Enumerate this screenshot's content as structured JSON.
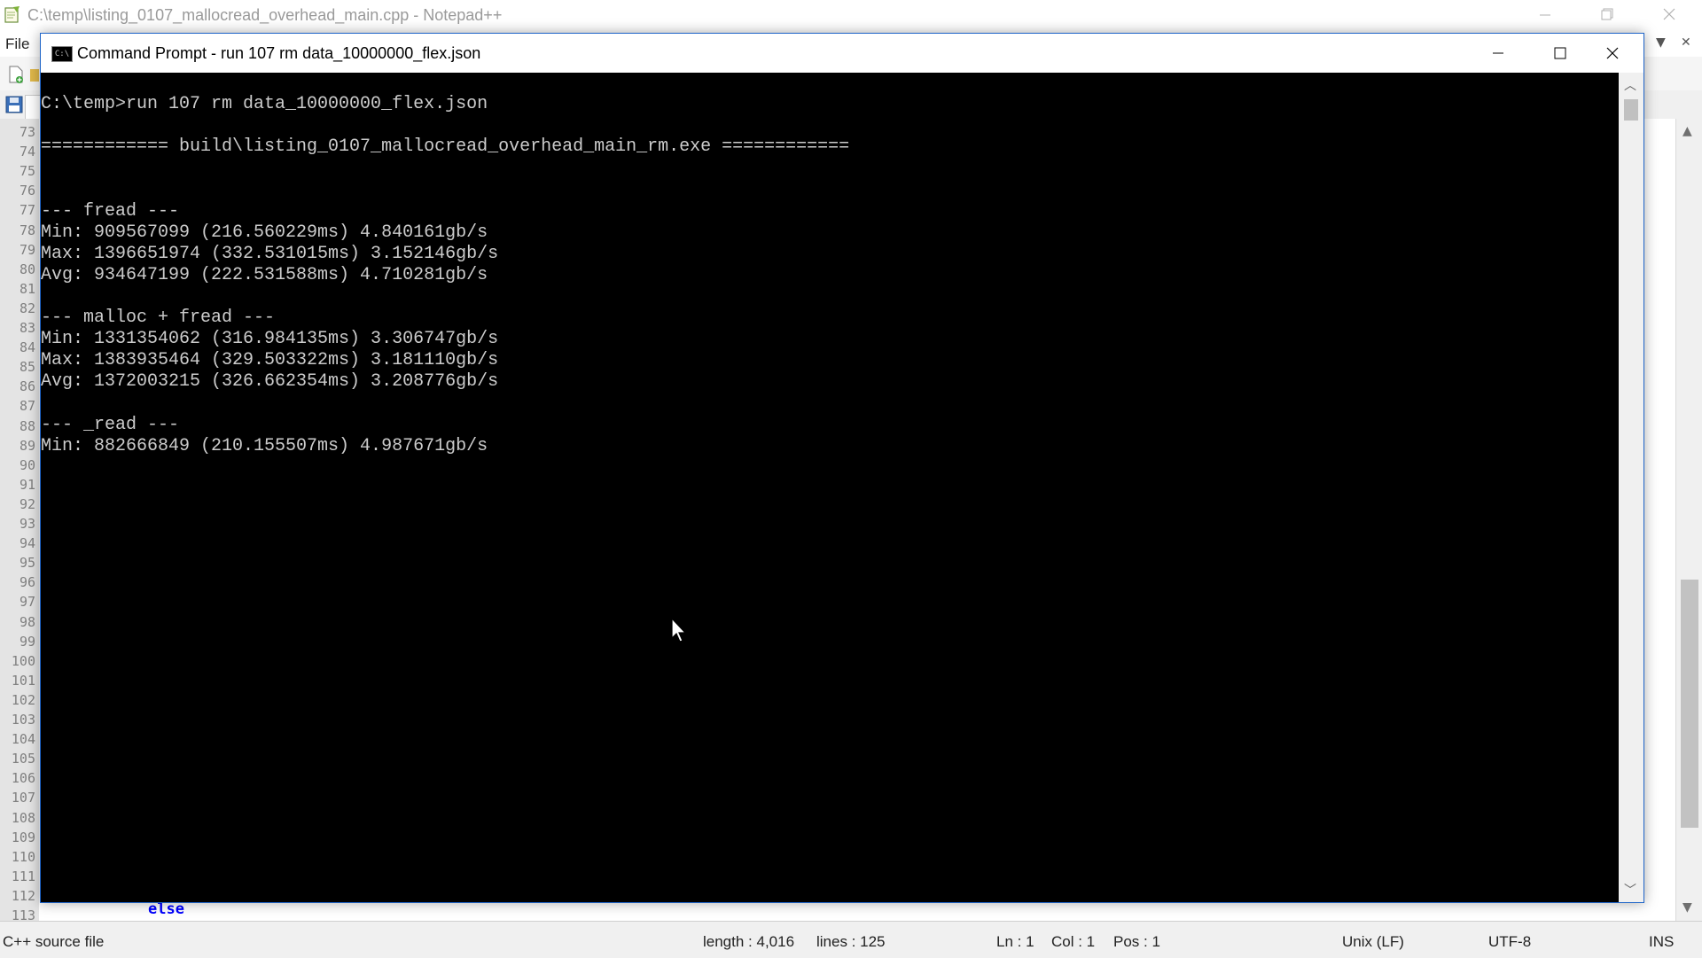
{
  "npp": {
    "title": "C:\\temp\\listing_0107_mallocread_overhead_main.cpp - Notepad++",
    "menu_file": "File",
    "menu_controls": [
      "▼",
      "✕"
    ],
    "line_numbers": [
      "73",
      "74",
      "75",
      "76",
      "77",
      "78",
      "79",
      "80",
      "81",
      "82",
      "83",
      "84",
      "85",
      "86",
      "87",
      "88",
      "89",
      "90",
      "91",
      "92",
      "93",
      "94",
      "95",
      "96",
      "97",
      "98",
      "99",
      "100",
      "101",
      "102",
      "103",
      "104",
      "105",
      "106",
      "107",
      "108",
      "109",
      "110",
      "111",
      "112",
      "113"
    ],
    "visible_code": "else",
    "status": {
      "file_type": "C++ source file",
      "length": "length : 4,016",
      "lines": "lines : 125",
      "ln": "Ln : 1",
      "col": "Col : 1",
      "pos": "Pos : 1",
      "eol": "Unix (LF)",
      "encoding": "UTF-8",
      "mode": "INS"
    }
  },
  "cmd": {
    "icon_text": "C:\\",
    "title": "Command Prompt - run  107 rm data_10000000_flex.json",
    "lines": [
      "",
      "C:\\temp>run 107 rm data_10000000_flex.json",
      "",
      "============ build\\listing_0107_mallocread_overhead_main_rm.exe ============",
      "",
      "",
      "--- fread ---",
      "Min: 909567099 (216.560229ms) 4.840161gb/s",
      "Max: 1396651974 (332.531015ms) 3.152146gb/s",
      "Avg: 934647199 (222.531588ms) 4.710281gb/s",
      "",
      "--- malloc + fread ---",
      "Min: 1331354062 (316.984135ms) 3.306747gb/s",
      "Max: 1383935464 (329.503322ms) 3.181110gb/s",
      "Avg: 1372003215 (326.662354ms) 3.208776gb/s",
      "",
      "--- _read ---",
      "Min: 882666849 (210.155507ms) 4.987671gb/s"
    ]
  },
  "colors": {
    "console_bg": "#000000",
    "console_text": "#cccccc",
    "cmd_border": "#1e64c8",
    "keyword": "#0000ff"
  }
}
